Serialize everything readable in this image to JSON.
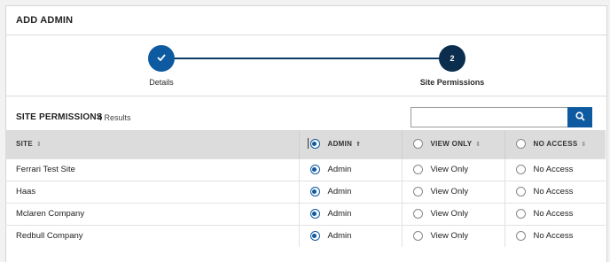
{
  "header": {
    "title": "ADD ADMIN"
  },
  "stepper": {
    "steps": [
      {
        "label": "Details",
        "marker": "✓",
        "state": "complete"
      },
      {
        "label": "Site Permissions",
        "marker": "2",
        "state": "current"
      }
    ]
  },
  "toolbar": {
    "title": "SITE PERMISSIONS",
    "count": "4",
    "count_suffix": "Results",
    "search_value": "",
    "search_placeholder": ""
  },
  "table": {
    "columns": [
      {
        "label": "SITE",
        "sort": "⇕"
      },
      {
        "label": "ADMIN",
        "sort": "⇑"
      },
      {
        "label": "VIEW ONLY",
        "sort": "⇕"
      },
      {
        "label": "NO ACCESS",
        "sort": "⇕"
      }
    ],
    "option_labels": [
      "Admin",
      "View Only",
      "No Access"
    ],
    "rows": [
      {
        "site": "Ferrari Test Site",
        "selected": "Admin"
      },
      {
        "site": "Haas",
        "selected": "Admin"
      },
      {
        "site": "Mclaren Company",
        "selected": "Admin"
      },
      {
        "site": "Redbull Company",
        "selected": "Admin"
      }
    ]
  },
  "colors": {
    "primary": "#0e5aa0",
    "primary_dark": "#0b2e4f",
    "header_bg": "#dcdcdc"
  },
  "icons": {
    "step_complete": "check-icon",
    "search": "search-icon"
  }
}
